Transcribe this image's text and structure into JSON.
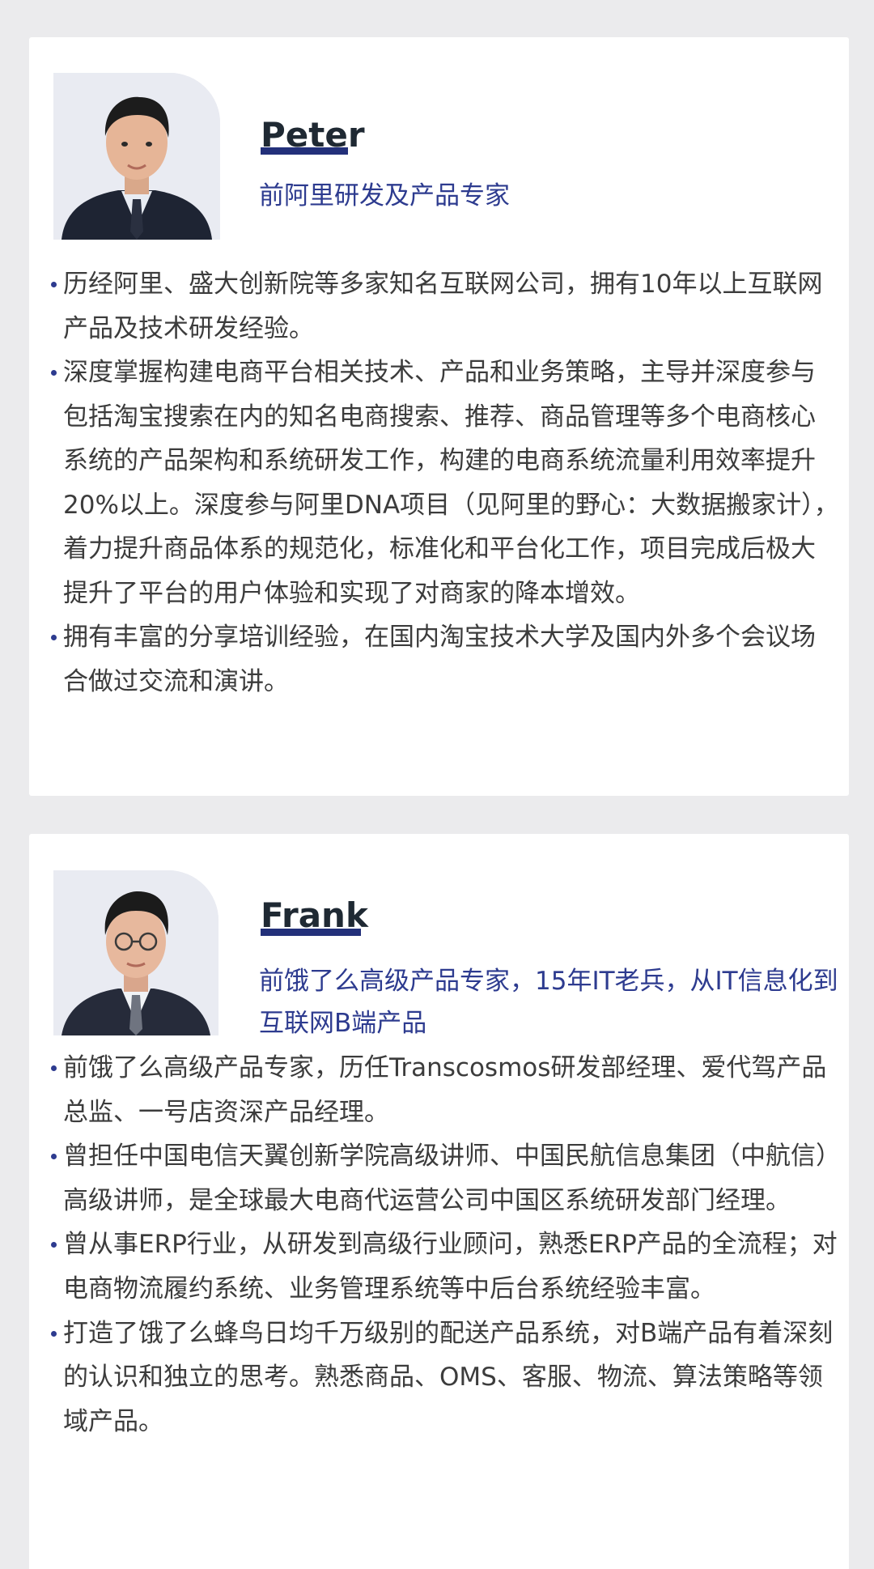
{
  "profiles": [
    {
      "name": "Peter",
      "title": "前阿里研发及产品专家",
      "bullets": [
        "历经阿里、盛大创新院等多家知名互联网公司，拥有10年以上互联网产品及技术研发经验。",
        "深度掌握构建电商平台相关技术、产品和业务策略，主导并深度参与包括淘宝搜索在内的知名电商搜索、推荐、商品管理等多个电商核心系统的产品架构和系统研发工作，构建的电商系统流量利用效率提升20%以上。深度参与阿里DNA项目（见阿里的野心：大数据搬家计），着力提升商品体系的规范化，标准化和平台化工作，项目完成后极大提升了平台的用户体验和实现了对商家的降本增效。",
        "拥有丰富的分享培训经验，在国内淘宝技术大学及国内外多个会议场合做过交流和演讲。"
      ]
    },
    {
      "name": "Frank",
      "title": "前饿了么高级产品专家，15年IT老兵，从IT信息化到互联网B端产品",
      "bullets": [
        "前饿了么高级产品专家，历任Transcosmos研发部经理、爱代驾产品总监、一号店资深产品经理。",
        "曾担任中国电信天翼创新学院高级讲师、中国民航信息集团（中航信）高级讲师，是全球最大电商代运营公司中国区系统研发部门经理。",
        "曾从事ERP行业，从研发到高级行业顾问，熟悉ERP产品的全流程；对电商物流履约系统、业务管理系统等中后台系统经验丰富。",
        "打造了饿了么蜂鸟日均千万级别的配送产品系统，对B端产品有着深刻的认识和独立的思考。熟悉商品、OMS、客服、物流、算法策略等领域产品。"
      ]
    }
  ],
  "colors": {
    "accent": "#23307a",
    "title": "#2d3b8f",
    "body_text": "#3c3c3c",
    "background": "#ebebed",
    "card": "#ffffff"
  }
}
